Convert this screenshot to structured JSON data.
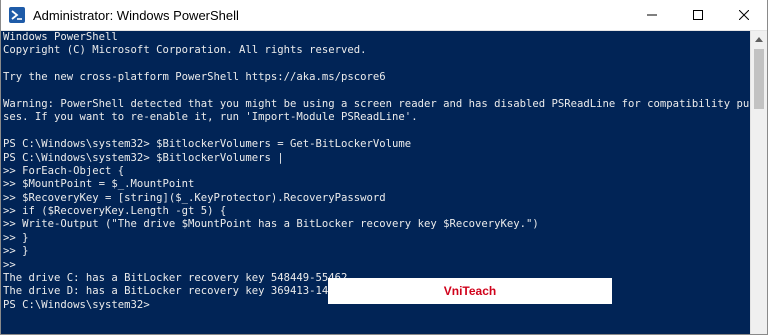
{
  "window": {
    "title": "Administrator: Windows PowerShell",
    "controls": {
      "minimize_icon": "minimize-icon",
      "maximize_icon": "maximize-icon",
      "close_icon": "close-icon"
    }
  },
  "console": {
    "background": "#012456",
    "lines": {
      "l1": "Windows PowerShell",
      "l2": "Copyright (C) Microsoft Corporation. All rights reserved.",
      "l4": "Try the new cross-platform PowerShell https://aka.ms/pscore6",
      "l6": "Warning: PowerShell detected that you might be using a screen reader and has disabled PSReadLine for compatibility purpo",
      "l7": "ses. If you want to re-enable it, run 'Import-Module PSReadLine'.",
      "l9": "PS C:\\Windows\\system32> $BitlockerVolumers = Get-BitLockerVolume",
      "l10": "PS C:\\Windows\\system32> $BitlockerVolumers |",
      "l11": ">> ForEach-Object {",
      "l12": ">> $MountPoint = $_.MountPoint",
      "l13": ">> $RecoveryKey = [string]($_.KeyProtector).RecoveryPassword",
      "l14": ">> if ($RecoveryKey.Length -gt 5) {",
      "l15": ">> Write-Output (\"The drive $MountPoint has a BitLocker recovery key $RecoveryKey.\")",
      "l16": ">> }",
      "l17": ">> }",
      "l18": ">>",
      "l19": "The drive C: has a BitLocker recovery key 548449-55462                                        .",
      "l20": "The drive D: has a BitLocker recovery key 369413-14204                                        .",
      "l21": "PS C:\\Windows\\system32>"
    },
    "watermark": "VniTeach"
  }
}
